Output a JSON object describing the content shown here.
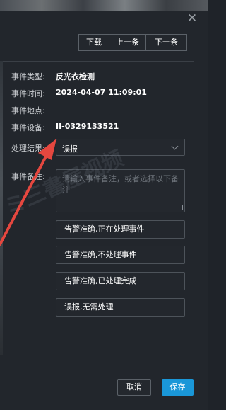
{
  "dialog": {
    "close_icon": "close-icon",
    "toolbar": {
      "download": "下载",
      "prev": "上一条",
      "next": "下一条"
    },
    "fields": {
      "type_label": "事件类型:",
      "type_value": "反光衣检测",
      "time_label": "事件时间:",
      "time_value": "2024-04-07 11:09:01",
      "location_label": "事件地点:",
      "location_value": "",
      "device_label": "事件设备:",
      "device_value": "II-0329133521",
      "result_label": "处理结果:",
      "result_value": "误报",
      "remark_label": "事件备注:",
      "remark_placeholder": "请输入事件备注，或者选择以下备注"
    },
    "quick_remarks": [
      "告警准确,正在处理事件",
      "告警准确,不处理事件",
      "告警准确,已处理完成",
      "误报,无需处理"
    ],
    "footer": {
      "cancel": "取消",
      "save": "保存"
    },
    "watermark": "ミ三書屋视频",
    "colors": {
      "background": "#22262c",
      "primary": "#1a97d8",
      "annotation_arrow": "#e5473f",
      "border": "#4d535a"
    }
  }
}
